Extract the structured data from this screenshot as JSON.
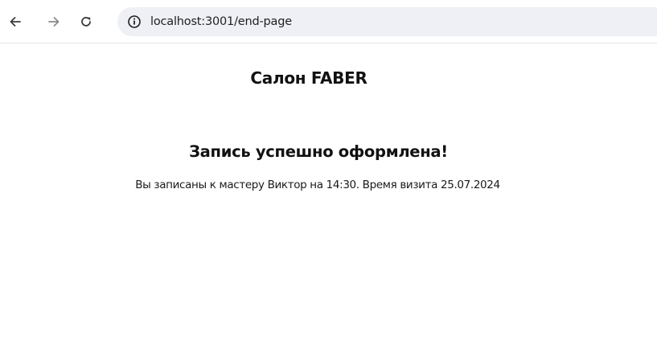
{
  "browser": {
    "url": "localhost:3001/end-page",
    "icons": {
      "back": "arrow-left-icon",
      "forward": "arrow-right-icon",
      "reload": "reload-icon",
      "site_info": "info-circle-icon"
    },
    "colors": {
      "omnibox_bg": "#eef0f5",
      "icon": "#3c3c3c",
      "icon_disabled": "#8a8a8a"
    }
  },
  "page": {
    "title": "Салон FABER",
    "heading": "Запись успешно оформлена!",
    "details": "Вы записаны к мастеру Виктор на 14:30. Время визита 25.07.2024"
  }
}
